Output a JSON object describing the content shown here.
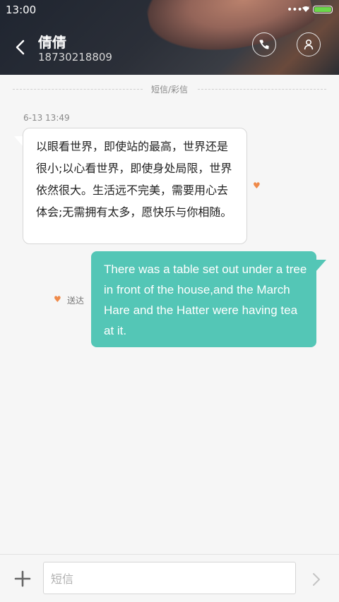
{
  "status_bar": {
    "time": "13:00",
    "battery_level": 1.0
  },
  "header": {
    "contact_name": "倩倩",
    "contact_number": "18730218809",
    "icons": {
      "back": "chevron-left-icon",
      "call": "phone-icon",
      "contact": "person-icon"
    }
  },
  "thread": {
    "channel_label": "短信/彩信",
    "messages": [
      {
        "direction": "incoming",
        "timestamp": "6-13 13:49",
        "text": "以眼看世界，即使站的最高，世界还是很小;以心看世界，即使身处局限，世界依然很大。生活远不完美，需要用心去体会;无需拥有太多，愿快乐与你相随。"
      },
      {
        "direction": "outgoing",
        "status": "送达",
        "text": "There was a table set out under a tree in front of the house,and the March Hare and the Hatter were having tea at it."
      }
    ]
  },
  "composer": {
    "placeholder": "短信",
    "value": "",
    "icons": {
      "add": "plus-icon",
      "send": "chevron-right-icon"
    }
  },
  "colors": {
    "outgoing_bubble": "#54c6b6",
    "incoming_bubble": "#ffffff",
    "heart": "#ef8a4a",
    "battery": "#6bd84a"
  }
}
